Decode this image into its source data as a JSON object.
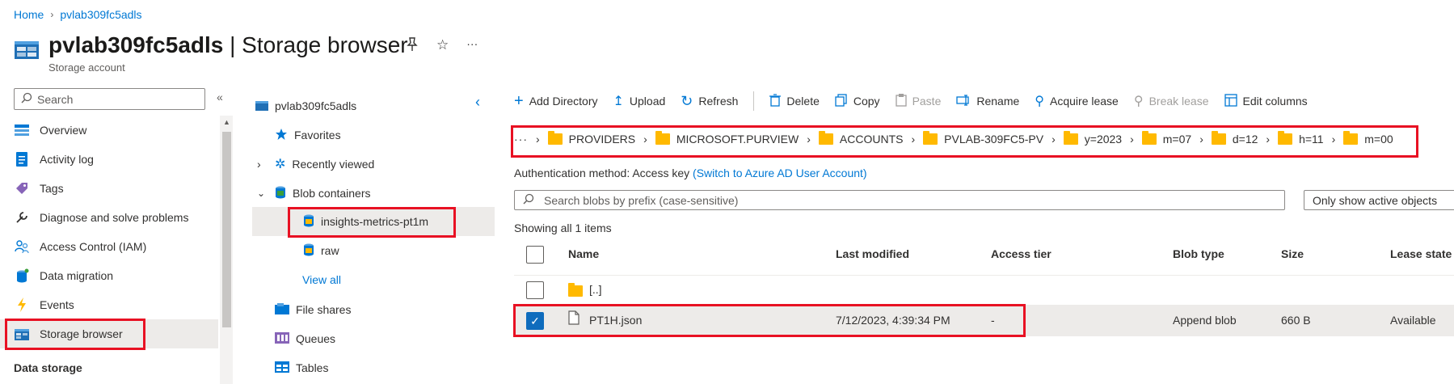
{
  "breadcrumb": {
    "home": "Home",
    "resource": "pvlab309fc5adls"
  },
  "header": {
    "title_bold": "pvlab309fc5adls",
    "title_rest": " | Storage browser",
    "subtitle": "Storage account",
    "pin_icon": "pin-icon",
    "star_icon": "star-icon",
    "more_label": "···"
  },
  "left_nav": {
    "search_placeholder": "Search",
    "collapse_label": "«",
    "items": [
      {
        "label": "Overview",
        "icon": "overview-icon"
      },
      {
        "label": "Activity log",
        "icon": "activity-log-icon"
      },
      {
        "label": "Tags",
        "icon": "tag-icon"
      },
      {
        "label": "Diagnose and solve problems",
        "icon": "wrench-icon"
      },
      {
        "label": "Access Control (IAM)",
        "icon": "people-icon"
      },
      {
        "label": "Data migration",
        "icon": "data-migration-icon"
      },
      {
        "label": "Events",
        "icon": "lightning-icon"
      },
      {
        "label": "Storage browser",
        "icon": "storage-browser-icon"
      }
    ],
    "selected_index": 7,
    "section_label": "Data storage"
  },
  "tree": {
    "root": "pvlab309fc5adls",
    "back_label": "‹",
    "items": {
      "favorites": "Favorites",
      "recently_viewed": "Recently viewed",
      "blob_containers": "Blob containers",
      "insights": "insights-metrics-pt1m",
      "raw": "raw",
      "view_all": "View all",
      "file_shares": "File shares",
      "queues": "Queues",
      "tables": "Tables"
    }
  },
  "toolbar": {
    "add_directory": "Add Directory",
    "upload": "Upload",
    "refresh": "Refresh",
    "delete": "Delete",
    "copy": "Copy",
    "paste": "Paste",
    "rename": "Rename",
    "acquire_lease": "Acquire lease",
    "break_lease": "Break lease",
    "edit_columns": "Edit columns"
  },
  "path": {
    "more": "···",
    "segments": [
      "PROVIDERS",
      "MICROSOFT.PURVIEW",
      "ACCOUNTS",
      "PVLAB-309FC5-PV",
      "y=2023",
      "m=07",
      "d=12",
      "h=11",
      "m=00"
    ]
  },
  "auth": {
    "label": "Authentication method:",
    "value": "Access key",
    "switch_link": "(Switch to Azure AD User Account)"
  },
  "blob_search": {
    "placeholder": "Search blobs by prefix (case-sensitive)"
  },
  "filter": {
    "value": "Only show active objects"
  },
  "showing": "Showing all 1 items",
  "table": {
    "columns": [
      "Name",
      "Last modified",
      "Access tier",
      "Blob type",
      "Size",
      "Lease state"
    ],
    "parent_row": {
      "name": "[..]"
    },
    "rows": [
      {
        "name": "PT1H.json",
        "last_modified": "7/12/2023, 4:39:34 PM",
        "access_tier": "-",
        "blob_type": "Append blob",
        "size": "660 B",
        "lease_state": "Available",
        "selected": true
      }
    ]
  },
  "colors": {
    "accent": "#0078d4",
    "highlight_border": "#e81123",
    "folder": "#ffb900",
    "selected_bg": "#edebe9"
  }
}
